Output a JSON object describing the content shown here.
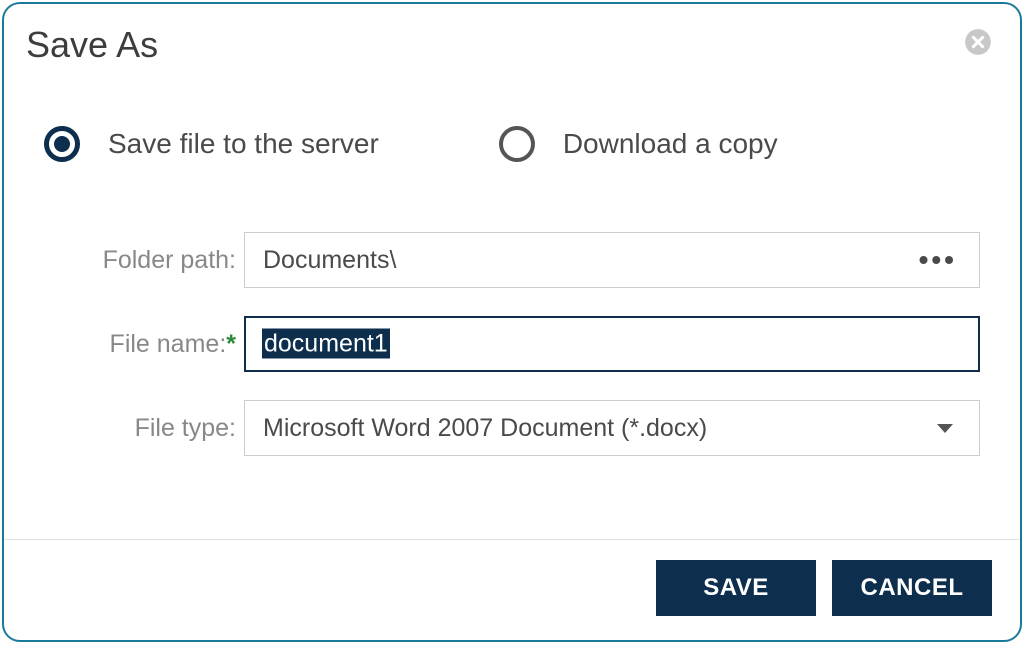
{
  "dialog": {
    "title": "Save As"
  },
  "options": {
    "save_server": "Save file to the server",
    "download": "Download a copy",
    "selected": "save_server"
  },
  "form": {
    "folder_label": "Folder path:",
    "folder_value": "Documents\\",
    "filename_label": "File name:",
    "filename_value": "document1",
    "filetype_label": "File type:",
    "filetype_value": "Microsoft Word 2007 Document (*.docx)"
  },
  "buttons": {
    "save": "SAVE",
    "cancel": "CANCEL"
  }
}
